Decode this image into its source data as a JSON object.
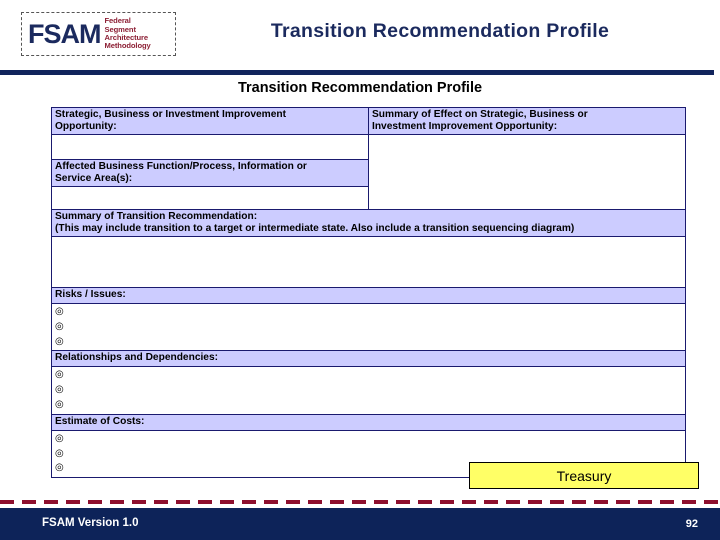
{
  "header": {
    "logo": {
      "mark": "FSAM",
      "tagline_line1": "Federal",
      "tagline_line2": "Segment",
      "tagline_line3": "Architecture",
      "tagline_line4": "Methodology"
    },
    "title": "Transition Recommendation Profile"
  },
  "subtitle": "Transition Recommendation Profile",
  "form": {
    "left_column": {
      "opportunity_header_line1": "Strategic, Business or Investment Improvement",
      "opportunity_header_line2": "Opportunity:",
      "affected_header_line1": "Affected Business Function/Process, Information or",
      "affected_header_line2": "Service Area(s):"
    },
    "right_column": {
      "effect_header_line1": "Summary of Effect on Strategic, Business or",
      "effect_header_line2": "Investment Improvement Opportunity:"
    },
    "summary": {
      "header_line1": "Summary of Transition Recommendation:",
      "header_line2": "(This may include transition to a target or intermediate state.  Also include a transition sequencing diagram)"
    },
    "sections": [
      {
        "title": "Risks / Issues:",
        "bullets": [
          "",
          "",
          ""
        ]
      },
      {
        "title": "Relationships and Dependencies:",
        "bullets": [
          "",
          "",
          ""
        ]
      },
      {
        "title": "Estimate of Costs:",
        "bullets": [
          "",
          "",
          ""
        ]
      }
    ],
    "bullet_glyph": "◎"
  },
  "callout": {
    "label": "Treasury"
  },
  "footer": {
    "version": "FSAM Version 1.0",
    "page_number": "92"
  },
  "colors": {
    "navy": "#11245c",
    "header_fill": "#ccccff",
    "border": "#1a1a6e",
    "callout_fill": "#ffff66",
    "dash_red": "#8d0f2e",
    "logo_red": "#8d2035"
  }
}
